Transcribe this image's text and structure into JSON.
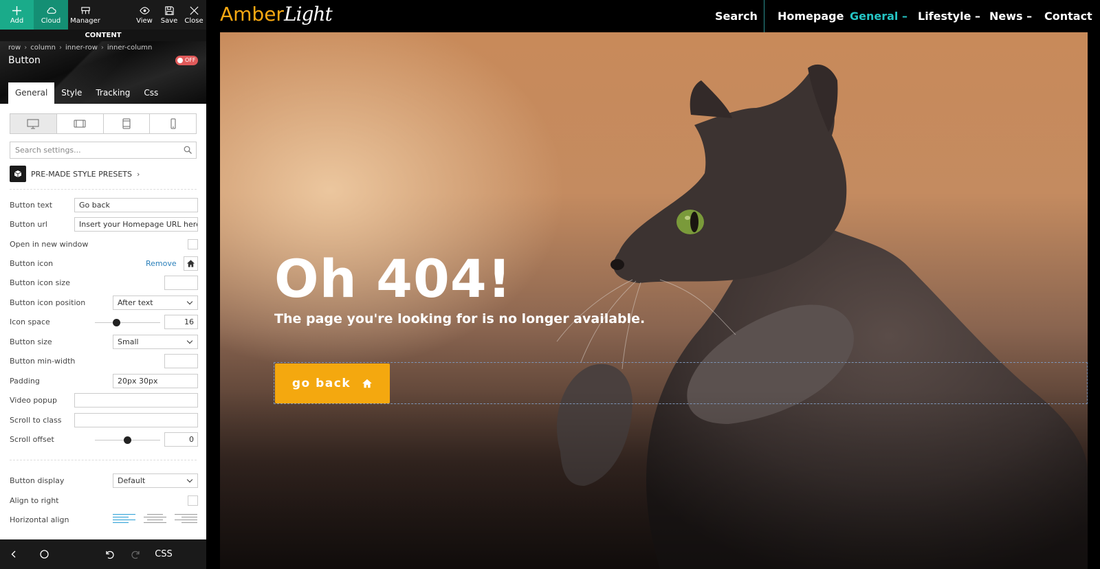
{
  "toolbar": {
    "add": "Add",
    "cloud": "Cloud",
    "manager": "Manager",
    "view": "View",
    "save": "Save",
    "close": "Close"
  },
  "panel": {
    "section_label": "CONTENT",
    "breadcrumb": [
      "row",
      "column",
      "inner-row",
      "inner-column"
    ],
    "element_title": "Button",
    "toggle_label": "OFF",
    "tabs": [
      "General",
      "Style",
      "Tracking",
      "Css"
    ],
    "active_tab": "General",
    "search_placeholder": "Search settings...",
    "presets_label": "PRE-MADE STYLE PRESETS",
    "fields": {
      "button_text": {
        "label": "Button text",
        "value": "Go back"
      },
      "button_url": {
        "label": "Button url",
        "value": "Insert your Homepage URL here"
      },
      "open_new_window": {
        "label": "Open in new window"
      },
      "button_icon": {
        "label": "Button icon",
        "remove": "Remove"
      },
      "button_icon_size": {
        "label": "Button icon size",
        "value": ""
      },
      "button_icon_position": {
        "label": "Button icon position",
        "value": "After text"
      },
      "icon_space": {
        "label": "Icon space",
        "value": "16"
      },
      "button_size": {
        "label": "Button size",
        "value": "Small"
      },
      "button_min_width": {
        "label": "Button min-width",
        "value": ""
      },
      "padding": {
        "label": "Padding",
        "value": "20px 30px"
      },
      "video_popup": {
        "label": "Video popup",
        "value": ""
      },
      "scroll_to_class": {
        "label": "Scroll to class",
        "value": ""
      },
      "scroll_offset": {
        "label": "Scroll offset",
        "value": "0"
      },
      "button_display": {
        "label": "Button display",
        "value": "Default"
      },
      "align_to_right": {
        "label": "Align to right"
      },
      "horizontal_align": {
        "label": "Horizontal align"
      }
    },
    "bottom_bar": {
      "css": "CSS"
    }
  },
  "site": {
    "logo_main": "Amber",
    "logo_accent": "Light",
    "nav": {
      "search": "Search",
      "homepage": "Homepage",
      "general": "General –",
      "lifestyle": "Lifestyle –",
      "news": "News –",
      "contact": "Contact"
    },
    "hero": {
      "title": "Oh 404!",
      "subtitle": "The page you're looking for is no longer available.",
      "button": "go back"
    }
  },
  "colors": {
    "accent_green": "#1aab8a",
    "button_orange": "#f4a80f",
    "nav_active": "#25c4c4",
    "off_toggle": "#e05a5a"
  }
}
